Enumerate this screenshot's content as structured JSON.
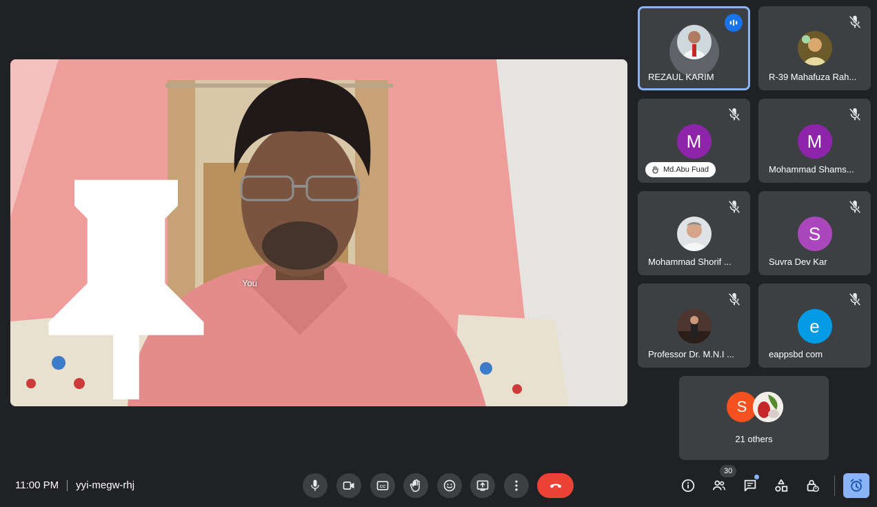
{
  "self_video": {
    "label": "You"
  },
  "participants": [
    {
      "name": "REZAUL KARIM",
      "state": "speaking"
    },
    {
      "name": "R-39 Mahafuza Rah...",
      "state": "muted"
    },
    {
      "name": "Md.Abu Fuad",
      "initial": "M",
      "avatar_color": "#8e24aa",
      "state": "muted",
      "hand_raised": true
    },
    {
      "name": "Mohammad Shams...",
      "initial": "M",
      "avatar_color": "#8e24aa",
      "state": "muted"
    },
    {
      "name": "Mohammad Shorif ...",
      "state": "muted"
    },
    {
      "name": "Suvra Dev Kar",
      "initial": "S",
      "avatar_color": "#ab47bc",
      "state": "muted"
    },
    {
      "name": "Professor Dr. M.N.I ...",
      "state": "muted"
    },
    {
      "name": "eappsbd com",
      "initial": "e",
      "avatar_color": "#039be5",
      "state": "muted"
    }
  ],
  "others": {
    "label": "21 others",
    "initial": "S",
    "avatar_color": "#f4511e"
  },
  "meeting": {
    "time": "11:00 PM",
    "code": "yyi-megw-rhj"
  },
  "controls": [
    "microphone-icon",
    "camera-icon",
    "captions-icon",
    "raise-hand-icon",
    "emoji-icon",
    "present-icon",
    "more-icon",
    "end-call-icon"
  ],
  "right_controls": {
    "people_count": "30"
  },
  "colors": {
    "background": "#202124",
    "tile": "#3c4043",
    "speaking_border": "#8ab4f8",
    "end_call": "#ea4335",
    "accent": "#1a73e8"
  }
}
